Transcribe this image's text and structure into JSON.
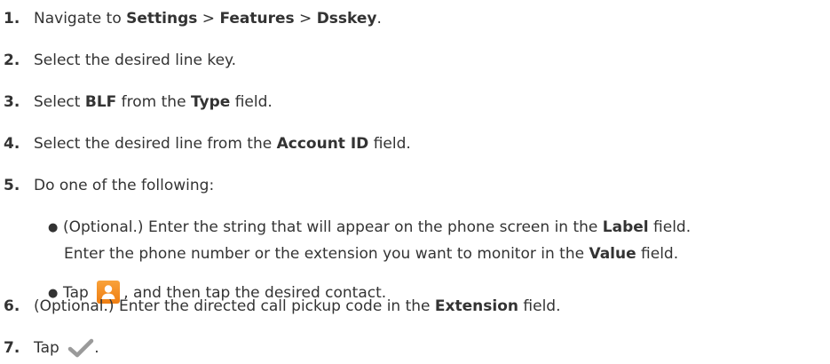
{
  "steps": [
    {
      "num": "1.",
      "t1": "Navigate to ",
      "b1": "Settings",
      "t2": " > ",
      "b2": "Features",
      "t3": " > ",
      "b3": "Dsskey",
      "t4": "."
    },
    {
      "num": "2.",
      "t1": "Select the desired line key."
    },
    {
      "num": "3.",
      "t1": "Select ",
      "b1": "BLF",
      "t2": " from the ",
      "b2": "Type",
      "t3": " field."
    },
    {
      "num": "4.",
      "t1": "Select the desired line from the ",
      "b1": "Account ID",
      "t2": " field."
    },
    {
      "num": "5.",
      "t1": "Do one of the following:"
    },
    {
      "num": "6.",
      "t1": "(Optional.) Enter the directed call pickup code in the ",
      "b1": "Extension",
      "t2": " field."
    },
    {
      "num": "7.",
      "t1": "Tap",
      "t2": "."
    }
  ],
  "bullets": [
    {
      "t1": "(Optional.) Enter the string that will appear on the phone screen in the ",
      "b1": "Label",
      "t2": " field."
    },
    {
      "t1": "Enter the phone number or the extension you want to monitor in the ",
      "b1": "Value",
      "t2": " field."
    },
    {
      "t1": "Tap",
      "t2": ", and then tap the desired contact."
    }
  ],
  "icons": {
    "contact": "contact-directory-icon",
    "confirm": "checkmark-icon"
  },
  "colors": {
    "contact_icon": "#f08a1c",
    "checkmark": "#9a9a9a",
    "text": "#333333"
  }
}
